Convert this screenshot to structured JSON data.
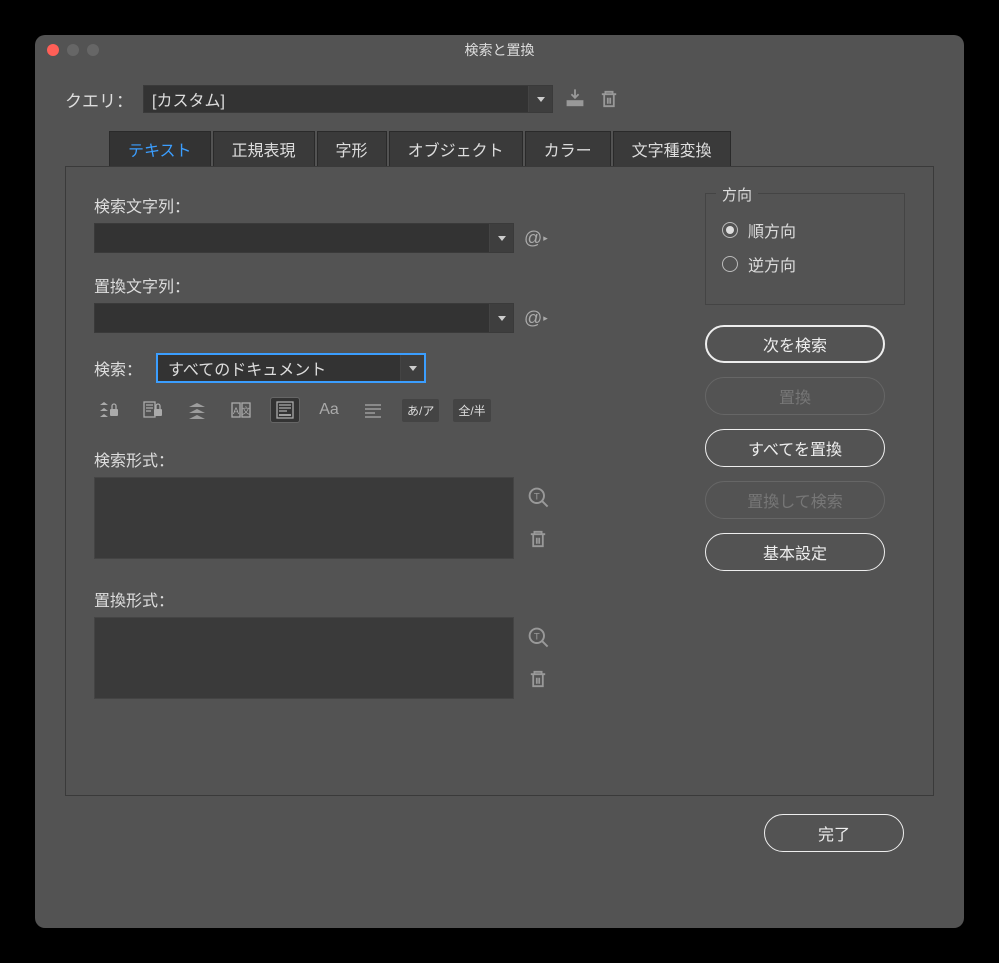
{
  "window": {
    "title": "検索と置換"
  },
  "query": {
    "label": "クエリ：",
    "value": "[カスタム]"
  },
  "tabs": [
    "テキスト",
    "正規表現",
    "字形",
    "オブジェクト",
    "カラー",
    "文字種変換"
  ],
  "fields": {
    "find_label": "検索文字列：",
    "replace_label": "置換文字列：",
    "search_label": "検索：",
    "scope": "すべてのドキュメント",
    "find_format_label": "検索形式：",
    "replace_format_label": "置換形式："
  },
  "toolbar": {
    "aa": "Aa",
    "kana": "あ/ア",
    "width": "全/半"
  },
  "direction": {
    "legend": "方向",
    "forward": "順方向",
    "backward": "逆方向"
  },
  "buttons": {
    "find_next": "次を検索",
    "replace": "置換",
    "replace_all": "すべてを置換",
    "replace_find": "置換して検索",
    "basic": "基本設定",
    "done": "完了"
  }
}
